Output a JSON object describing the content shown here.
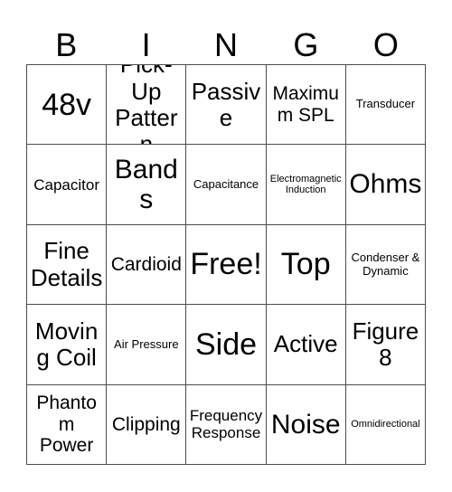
{
  "card": {
    "title": "BINGO",
    "header_letters": [
      "B",
      "I",
      "N",
      "G",
      "O"
    ],
    "colors": {
      "background": "#ffffff",
      "text": "#000000",
      "grid_line": "#4d4d4d"
    },
    "grid": {
      "columns": 5,
      "rows": 5,
      "free_space_label": "Free!",
      "free_space_position": {
        "row": 3,
        "column": 3
      }
    },
    "rows": [
      [
        {
          "label": "48v",
          "size": "xxl"
        },
        {
          "label": "Pick-Up Pattern",
          "size": "lg"
        },
        {
          "label": "Passive",
          "size": "lg"
        },
        {
          "label": "Maximum SPL",
          "size": "md"
        },
        {
          "label": "Transducer",
          "size": "xs"
        }
      ],
      [
        {
          "label": "Capacitor",
          "size": "sm"
        },
        {
          "label": "Bands",
          "size": "xl"
        },
        {
          "label": "Capacitance",
          "size": "xs"
        },
        {
          "label": "Electromagnetic Induction",
          "size": "xxs"
        },
        {
          "label": "Ohms",
          "size": "xl"
        }
      ],
      [
        {
          "label": "Fine Details",
          "size": "lg"
        },
        {
          "label": "Cardioid",
          "size": "md"
        },
        {
          "label": "Free!",
          "size": "xxl"
        },
        {
          "label": "Top",
          "size": "xxl"
        },
        {
          "label": "Condenser & Dynamic",
          "size": "xs"
        }
      ],
      [
        {
          "label": "Moving Coil",
          "size": "lg"
        },
        {
          "label": "Air Pressure",
          "size": "xs"
        },
        {
          "label": "Side",
          "size": "xxl"
        },
        {
          "label": "Active",
          "size": "lg"
        },
        {
          "label": "Figure 8",
          "size": "lg"
        }
      ],
      [
        {
          "label": "Phantom Power",
          "size": "md"
        },
        {
          "label": "Clipping",
          "size": "md"
        },
        {
          "label": "Frequency Response",
          "size": "sm"
        },
        {
          "label": "Noise",
          "size": "xl"
        },
        {
          "label": "Omnidirectional",
          "size": "xxs"
        }
      ]
    ]
  }
}
